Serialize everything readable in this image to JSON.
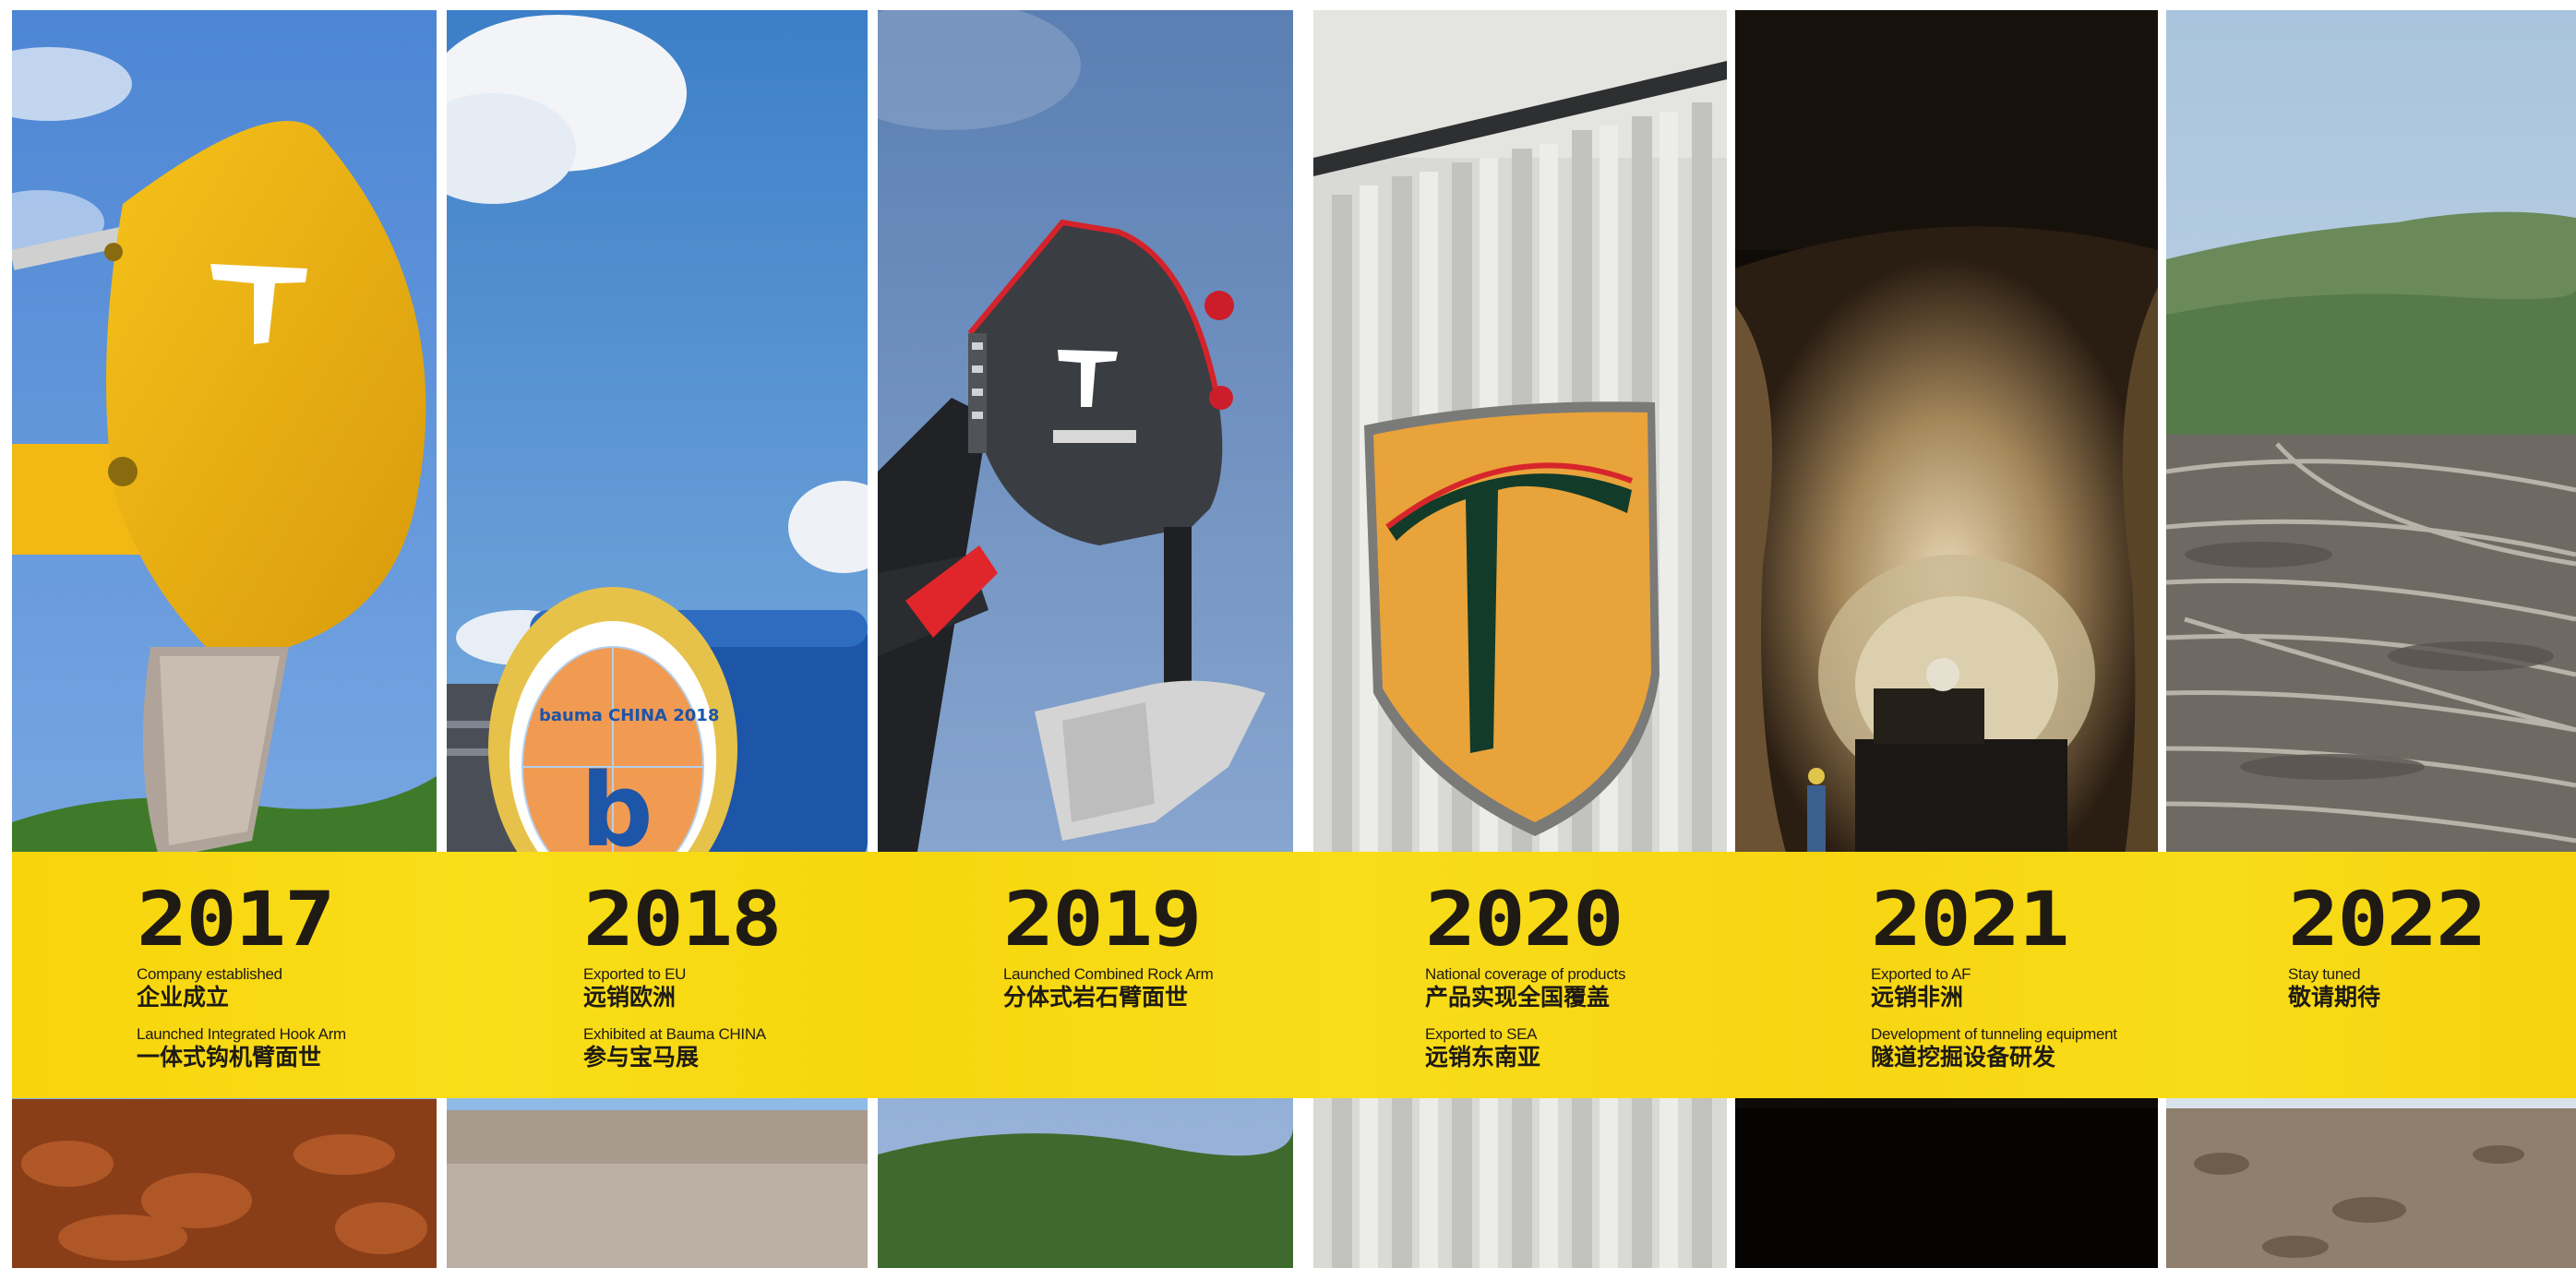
{
  "timeline": [
    {
      "year": "2017",
      "lines": [
        {
          "en": "Company established",
          "zh": "企业成立"
        },
        {
          "en": "Launched Integrated Hook Arm",
          "zh": "一体式钩机臂面世"
        }
      ]
    },
    {
      "year": "2018",
      "lines": [
        {
          "en": "Exported to EU",
          "zh": "远销欧洲"
        },
        {
          "en": "Exhibited at Bauma CHINA",
          "zh": "参与宝马展"
        }
      ]
    },
    {
      "year": "2019",
      "lines": [
        {
          "en": "Launched Combined Rock Arm",
          "zh": "分体式岩石臂面世"
        }
      ]
    },
    {
      "year": "2020",
      "lines": [
        {
          "en": "National coverage of products",
          "zh": "产品实现全国覆盖"
        },
        {
          "en": "Exported to SEA",
          "zh": "远销东南亚"
        }
      ]
    },
    {
      "year": "2021",
      "lines": [
        {
          "en": "Exported to AF",
          "zh": "远销非洲"
        },
        {
          "en": "Development  of tunneling equipment",
          "zh": "隧道挖掘设备研发"
        }
      ]
    },
    {
      "year": "2022",
      "lines": [
        {
          "en": "Stay tuned",
          "zh": "敬请期待"
        }
      ]
    }
  ],
  "photos": {
    "bauma_sign": "bauma CHINA 2018"
  },
  "colors": {
    "band_yellow": "#f8d70f",
    "text_dark": "#1f1b14",
    "sky_blue": "#6f9fd8",
    "logo_orange": "#e8a33a",
    "logo_green": "#123b2a"
  }
}
